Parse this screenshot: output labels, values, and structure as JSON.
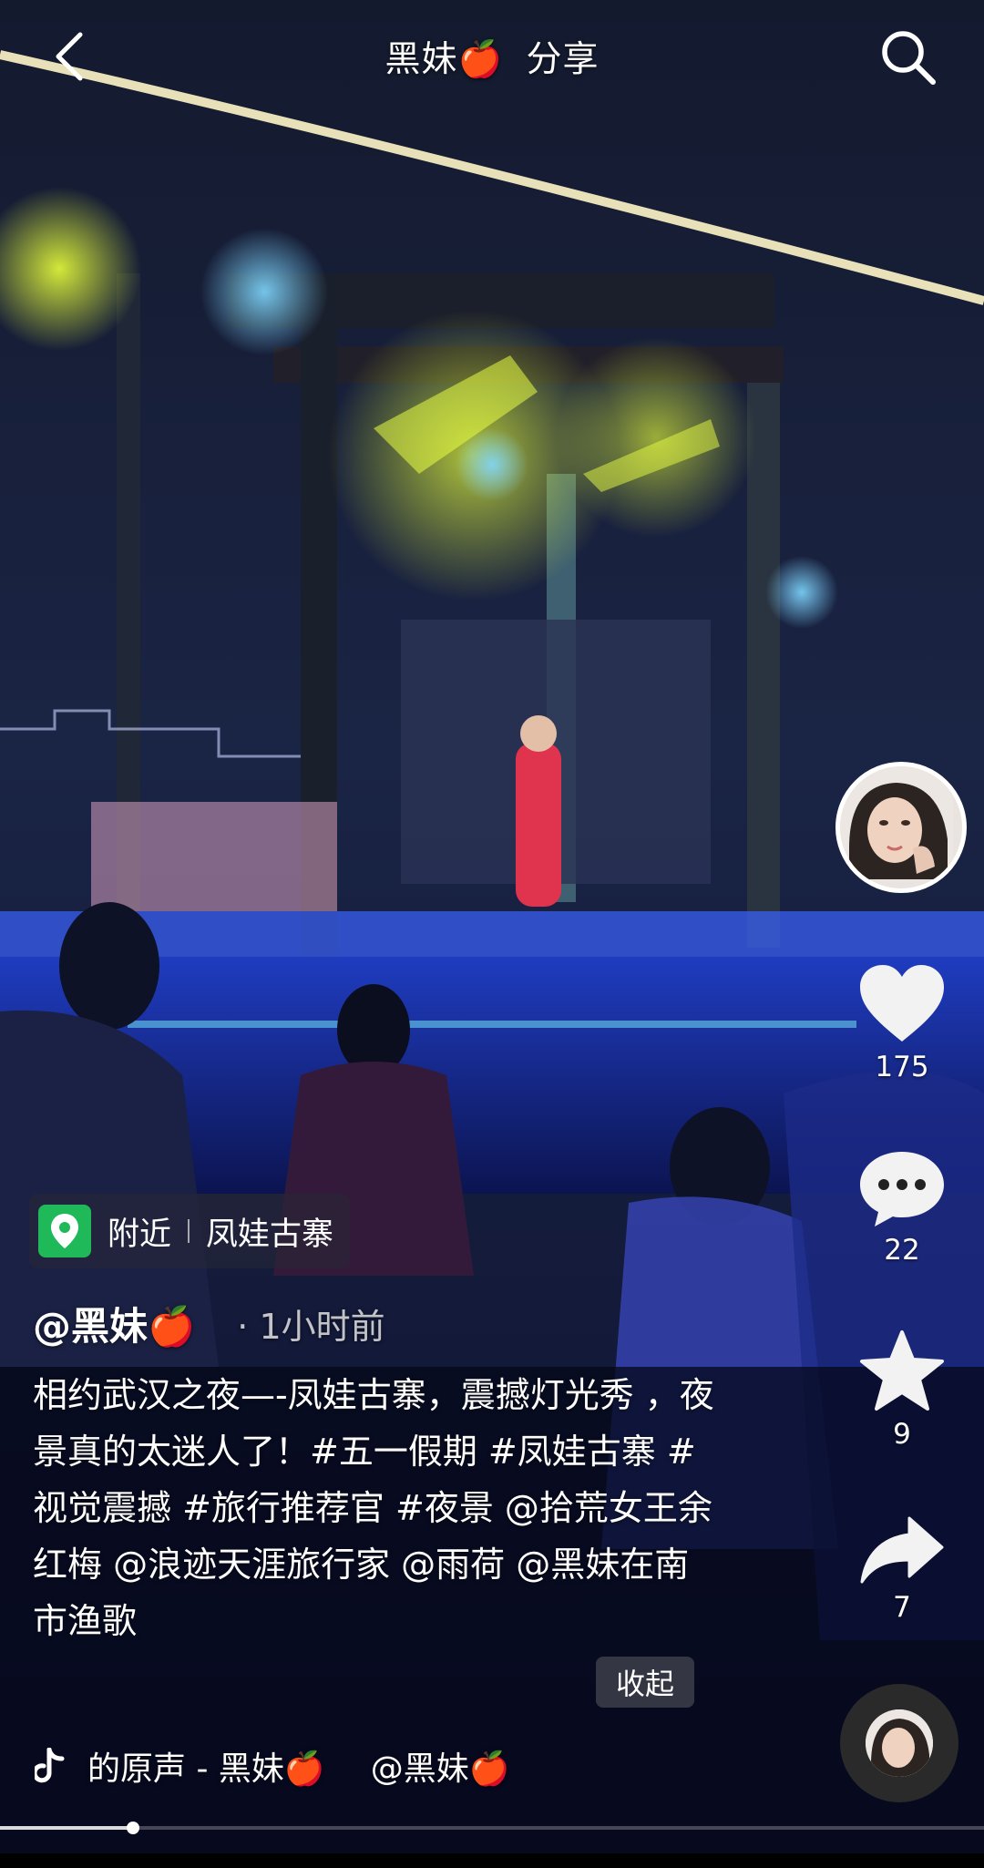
{
  "header": {
    "title_name": "黑妹🍎",
    "title_action": "分享"
  },
  "side": {
    "likes": "175",
    "comments": "22",
    "favorites": "9",
    "shares": "7"
  },
  "location": {
    "prefix": "附近",
    "place": "凤娃古寨"
  },
  "post": {
    "author": "@黑妹🍎",
    "time": "· 1小时前",
    "description": "相约武汉之夜—-凤娃古寨，震撼灯光秀 ，夜景真的太迷人了！#五一假期 #凤娃古寨 #视觉震撼 #旅行推荐官 #夜景 @拾荒女王余红梅 @浪迹天涯旅行家 @雨荷 @黑妹在南市渔歌",
    "collapse_label": "收起"
  },
  "music": {
    "title": "的原声 - 黑妹🍎",
    "mention": "@黑妹🍎"
  },
  "playback": {
    "progress_fraction": 0.135
  },
  "colors": {
    "location_green": "#20b95a",
    "background": "#0a0d2a"
  },
  "icons": {
    "back": "chevron-left",
    "search": "magnifier",
    "like": "heart",
    "comment": "speech-bubble-dots",
    "favorite": "star",
    "share": "curved-arrow"
  }
}
